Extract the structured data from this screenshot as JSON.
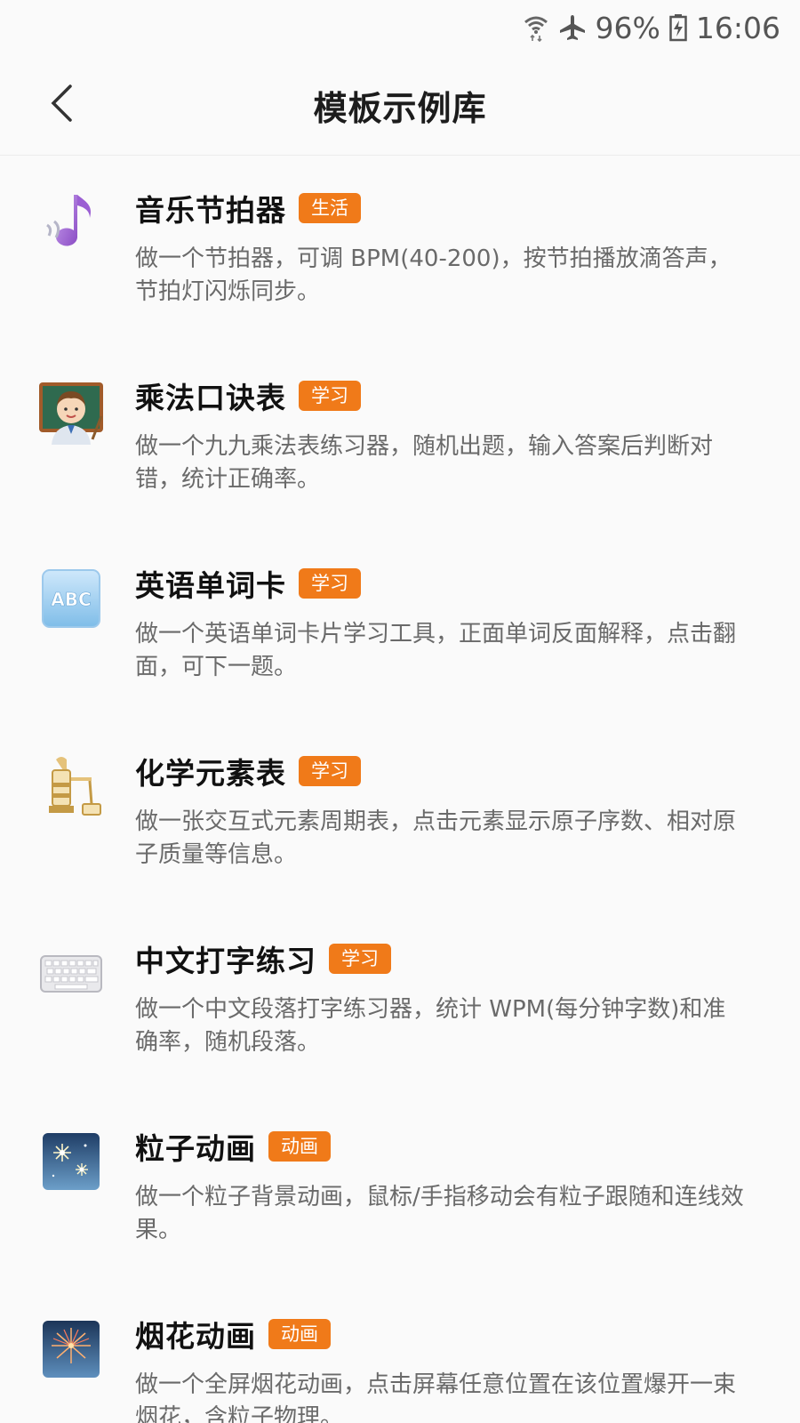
{
  "status_bar": {
    "battery": "96%",
    "time": "16:06",
    "icons": [
      "wifi-icon",
      "airplane-mode-icon",
      "battery-charging-icon"
    ]
  },
  "header": {
    "title": "模板示例库",
    "back_icon": "chevron-left-icon"
  },
  "colors": {
    "tag_bg": "#f07a19",
    "title_text": "#111111",
    "desc_text": "#6a6a6a"
  },
  "templates": [
    {
      "title": "音乐节拍器",
      "tag": "生活",
      "icon": "musical-note-icon",
      "desc": "做一个节拍器，可调 BPM(40-200)，按节拍播放滴答声，节拍灯闪烁同步。"
    },
    {
      "title": "乘法口诀表",
      "tag": "学习",
      "icon": "teacher-icon",
      "desc": "做一个九九乘法表练习器，随机出题，输入答案后判断对错，统计正确率。"
    },
    {
      "title": "英语单词卡",
      "tag": "学习",
      "icon": "abc-icon",
      "desc": "做一个英语单词卡片学习工具，正面单词反面解释，点击翻面，可下一题。"
    },
    {
      "title": "化学元素表",
      "tag": "学习",
      "icon": "alembic-icon",
      "desc": "做一张交互式元素周期表，点击元素显示原子序数、相对原子质量等信息。"
    },
    {
      "title": "中文打字练习",
      "tag": "学习",
      "icon": "keyboard-icon",
      "desc": "做一个中文段落打字练习器，统计 WPM(每分钟字数)和准确率，随机段落。"
    },
    {
      "title": "粒子动画",
      "tag": "动画",
      "icon": "sparkler-icon",
      "desc": "做一个粒子背景动画，鼠标/手指移动会有粒子跟随和连线效果。"
    },
    {
      "title": "烟花动画",
      "tag": "动画",
      "icon": "fireworks-icon",
      "desc": "做一个全屏烟花动画，点击屏幕任意位置在该位置爆开一束烟花，含粒子物理。"
    }
  ]
}
